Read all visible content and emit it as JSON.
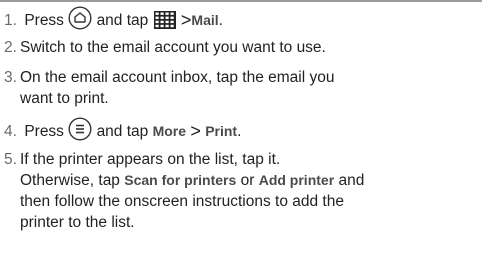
{
  "steps": [
    {
      "number": "1.",
      "before_icon": "Press",
      "icon": "home-icon",
      "middle": "and tap",
      "icon2": "all-apps-grid-icon",
      "separator": ">",
      "target": "Mail",
      "end": "."
    },
    {
      "number": "2.",
      "text": "Switch to the email account you want to use."
    },
    {
      "number": "3.",
      "line1": "On the email account inbox, tap the email you",
      "line2": "want to print."
    },
    {
      "number": "4.",
      "before_icon": "Press",
      "icon": "menu-icon",
      "middle": "and tap",
      "target1": "More",
      "separator": ">",
      "target2": "Print",
      "end": "."
    },
    {
      "number": "5.",
      "line1": "If the printer appears on the list, tap it.",
      "line2_before": "Otherwise, tap",
      "option1": "Scan for printers",
      "line2_or": "or",
      "option2": "Add printer",
      "line2_after": "and",
      "line3": "then follow the onscreen instructions to add the",
      "line4": "printer to the list."
    }
  ]
}
